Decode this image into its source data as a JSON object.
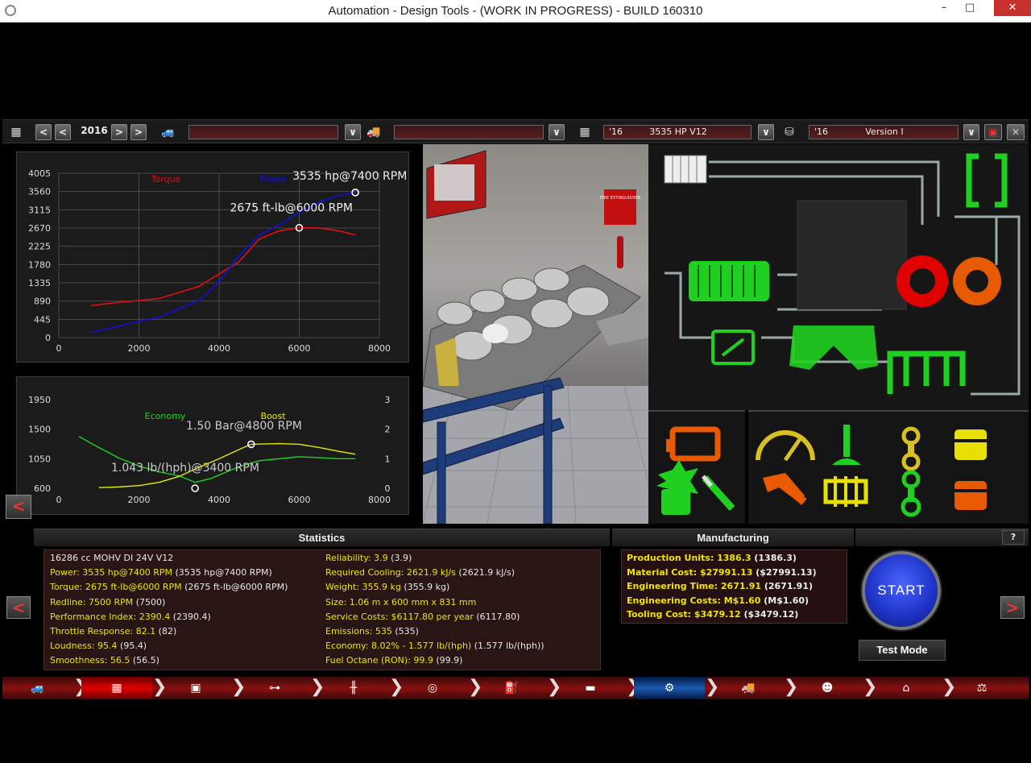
{
  "window": {
    "title": "Automation - Design Tools - (WORK IN PROGRESS) - BUILD 160310",
    "minimize": "–",
    "maximize": "□",
    "close": "✕"
  },
  "toolbar": {
    "year": "2016",
    "prev_decade": "<",
    "prev_year": "<",
    "next_year": ">",
    "next_decade": ">",
    "car_model": "",
    "car_trim": "",
    "engine_year": "'16",
    "engine_name": "3535 HP V12",
    "variant_year": "'16",
    "variant_name": "Version I",
    "dropdown": "∨",
    "close": "✕"
  },
  "chart_data": [
    {
      "type": "line",
      "legend": [
        "Torque",
        "Power"
      ],
      "xlim": [
        0,
        8000
      ],
      "x_ticks": [
        "0",
        "2000",
        "4000",
        "6000",
        "8000"
      ],
      "y_ticks": [
        "0",
        "445",
        "890",
        "1335",
        "1780",
        "2225",
        "2670",
        "3115",
        "3560",
        "4005"
      ],
      "ylim": [
        0,
        4005
      ],
      "grid": true,
      "series": [
        {
          "name": "Torque",
          "color": "#e01010",
          "x": [
            800,
            1500,
            2500,
            3500,
            4500,
            5000,
            5500,
            6000,
            6500,
            7000,
            7400
          ],
          "y": [
            780,
            860,
            950,
            1250,
            1850,
            2400,
            2600,
            2675,
            2670,
            2600,
            2500
          ]
        },
        {
          "name": "Power",
          "color": "#1010e0",
          "x": [
            800,
            1500,
            2500,
            3500,
            4000,
            4500,
            5000,
            5500,
            6000,
            6500,
            7000,
            7400
          ],
          "y": [
            130,
            280,
            500,
            900,
            1350,
            2000,
            2500,
            2750,
            3050,
            3300,
            3470,
            3535
          ]
        }
      ],
      "annotations": [
        {
          "text": "3535 hp@7400 RPM",
          "x": 7400,
          "y": 3535
        },
        {
          "text": "2675 ft-lb@6000 RPM",
          "x": 6000,
          "y": 2675
        }
      ]
    },
    {
      "type": "line",
      "legend": [
        "Economy",
        "Boost"
      ],
      "xlim": [
        0,
        8000
      ],
      "x_ticks": [
        "0",
        "2000",
        "4000",
        "6000",
        "8000"
      ],
      "y_ticks_left": [
        "600",
        "1050",
        "1500",
        "1950"
      ],
      "ylim_left": [
        600,
        1950
      ],
      "y_ticks_right": [
        "0",
        "1",
        "2",
        "3"
      ],
      "ylim_right": [
        0,
        3
      ],
      "grid": false,
      "series": [
        {
          "name": "Economy",
          "color": "#20d020",
          "axis": "left",
          "x": [
            500,
            1000,
            1500,
            2000,
            2500,
            3000,
            3400,
            3800,
            4500,
            5000,
            6000,
            7000,
            7400
          ],
          "y": [
            1390,
            1220,
            1060,
            940,
            850,
            790,
            690,
            750,
            930,
            1020,
            1080,
            1050,
            1050
          ]
        },
        {
          "name": "Boost",
          "color": "#e8e800",
          "axis": "left",
          "x": [
            1000,
            1500,
            2000,
            2500,
            3000,
            3500,
            4000,
            4500,
            4800,
            5500,
            6000,
            6500,
            7000,
            7400
          ],
          "y": [
            610,
            620,
            640,
            690,
            780,
            920,
            1050,
            1190,
            1270,
            1280,
            1270,
            1220,
            1160,
            1120
          ]
        }
      ],
      "annotations": [
        {
          "text": "1.50 Bar@4800 RPM",
          "x": 4800,
          "y": 1270
        },
        {
          "text": "1.043 lb/(hph)@3400 RPM",
          "x": 3400,
          "y": 600
        }
      ]
    }
  ],
  "chart_collapse": "<",
  "sections": {
    "statistics": "Statistics",
    "manufacturing": "Manufacturing",
    "help": "?"
  },
  "stats_left": [
    {
      "label": "16286 cc MOHV DI 24V V12",
      "val": "",
      "ref": "",
      "plain": true
    },
    {
      "label": "Power:",
      "val": "3535 hp@7400 RPM",
      "ref": "(3535 hp@7400 RPM)"
    },
    {
      "label": "Torque:",
      "val": "2675 ft-lb@6000 RPM",
      "ref": "(2675 ft-lb@6000 RPM)"
    },
    {
      "label": "Redline:",
      "val": "7500 RPM",
      "ref": "(7500)"
    },
    {
      "label": "Performance Index:",
      "val": "2390.4",
      "ref": "(2390.4)"
    },
    {
      "label": "Throttle Response:",
      "val": "82.1",
      "ref": "(82)"
    },
    {
      "label": "Loudness:",
      "val": "95.4",
      "ref": "(95.4)"
    },
    {
      "label": "Smoothness:",
      "val": "56.5",
      "ref": "(56.5)"
    }
  ],
  "stats_right": [
    {
      "label": "Reliability:",
      "val": "3.9",
      "ref": "(3.9)"
    },
    {
      "label": "Required Cooling:",
      "val": "2621.9 kJ/s",
      "ref": "(2621.9 kJ/s)"
    },
    {
      "label": "Weight:",
      "val": "355.9 kg",
      "ref": "(355.9 kg)"
    },
    {
      "label": "Size:",
      "val": "1.06 m x 600 mm x 831 mm",
      "ref": ""
    },
    {
      "label": "Service Costs:",
      "val": "$6117.80 per year",
      "ref": "(6117.80)"
    },
    {
      "label": "Emissions:",
      "val": "535",
      "ref": "(535)"
    },
    {
      "label": "Economy:",
      "val": "8.02% - 1.577 lb/(hph)",
      "ref": "(1.577 lb/(hph))"
    },
    {
      "label": "Fuel Octane (RON):",
      "val": "99.9",
      "ref": "(99.9)"
    }
  ],
  "manufacturing": [
    {
      "label": "Production Units:",
      "val": "1386.3",
      "ref": "(1386.3)"
    },
    {
      "label": "Material Cost:",
      "val": "$27991.13",
      "ref": "($27991.13)"
    },
    {
      "label": "Engineering Time:",
      "val": "2671.91",
      "ref": "(2671.91)"
    },
    {
      "label": "Engineering Costs:",
      "val": "M$1.60",
      "ref": "(M$1.60)"
    },
    {
      "label": "Tooling Cost:",
      "val": "$3479.12",
      "ref": "($3479.12)"
    }
  ],
  "buttons": {
    "start": "START",
    "test_mode": "Test Mode",
    "prev": "<",
    "next": ">"
  },
  "viewport": {
    "sign_text": "FIRE EXTINGUISHER"
  },
  "nav_items": [
    {
      "icon": "car-body-icon",
      "glyph": "🚙"
    },
    {
      "icon": "engine-block-icon",
      "glyph": "▦"
    },
    {
      "icon": "cylinder-head-icon",
      "glyph": "▣"
    },
    {
      "icon": "crankshaft-icon",
      "glyph": "⊶"
    },
    {
      "icon": "valvetrain-icon",
      "glyph": "╫"
    },
    {
      "icon": "turbo-icon",
      "glyph": "◎"
    },
    {
      "icon": "fuel-system-icon",
      "glyph": "⛽"
    },
    {
      "icon": "exhaust-icon",
      "glyph": "▬"
    },
    {
      "icon": "engine-tune-icon",
      "glyph": "⚙"
    },
    {
      "icon": "car-tuning-icon",
      "glyph": "🚚"
    },
    {
      "icon": "driver-icon",
      "glyph": "☻"
    },
    {
      "icon": "factory-icon",
      "glyph": "⌂"
    },
    {
      "icon": "balance-scale-icon",
      "glyph": "⚖"
    }
  ],
  "colors": {
    "torque": "#e01010",
    "power": "#1010e0",
    "economy": "#20d020",
    "boost": "#e8e800",
    "stat_text": "#e8e600",
    "nav_red": "#8a1010",
    "start_blue": "#1d32c4"
  }
}
